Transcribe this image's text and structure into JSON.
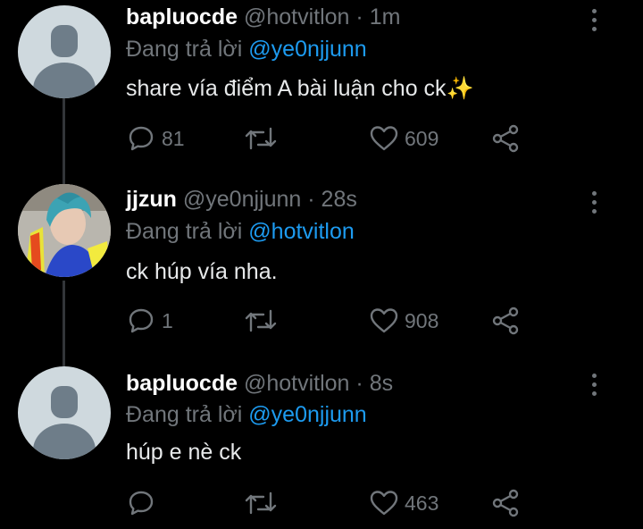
{
  "tweets": [
    {
      "name": "bapluocde",
      "handle": "@hotvitlon",
      "time": "· 1m",
      "replying_prefix": "Đang trả lời",
      "replying_to": "@ye0njjunn",
      "text": "share vía điểm A bài luận cho ck✨",
      "replies": "81",
      "retweets": "",
      "likes": "609",
      "avatar": "default-avatar"
    },
    {
      "name": "jjzun",
      "handle": "@ye0njjunn",
      "time": "· 28s",
      "replying_prefix": "Đang trả lời",
      "replying_to": "@hotvitlon",
      "text": "ck húp vía nha.",
      "replies": "1",
      "retweets": "",
      "likes": "908",
      "avatar": "photo-avatar"
    },
    {
      "name": "bapluocde",
      "handle": "@hotvitlon",
      "time": "· 8s",
      "replying_prefix": "Đang trả lời",
      "replying_to": "@ye0njjunn",
      "text": "húp e nè ck",
      "replies": "",
      "retweets": "",
      "likes": "463",
      "avatar": "default-avatar"
    }
  ],
  "icons": {
    "reply": "reply-icon",
    "retweet": "retweet-icon",
    "like": "heart-icon",
    "share": "share-icon",
    "more": "more-vertical-icon"
  },
  "colors": {
    "background": "#000000",
    "name": "#ffffff",
    "muted": "#71767b",
    "mention": "#1d9bf0",
    "thread_line": "#333639"
  }
}
